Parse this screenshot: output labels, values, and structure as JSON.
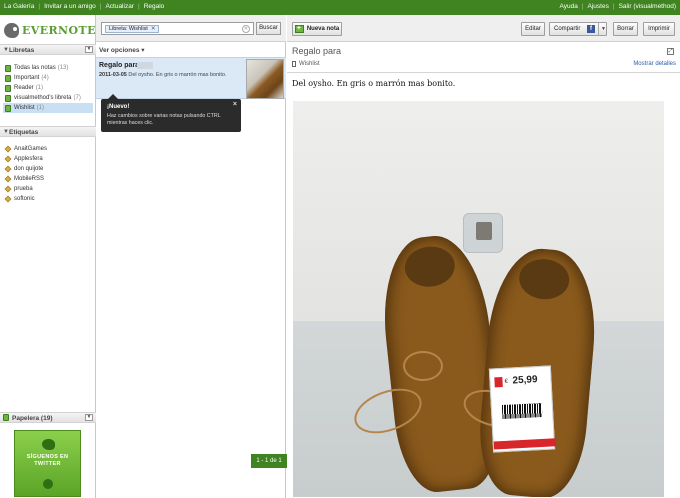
{
  "topbar": {
    "left_links": [
      "La Galería",
      "Invitar a un amigo",
      "Actualizar",
      "Regalo"
    ],
    "right_links": [
      "Ayuda",
      "Ajustes",
      "Salir (visualmethod)"
    ]
  },
  "logo": {
    "text": "EVERNOTE"
  },
  "sidebar": {
    "notebooks_header": "Libretas",
    "notebooks": [
      {
        "name": "Todas las notas",
        "count": "(13)"
      },
      {
        "name": "Important",
        "count": "(4)"
      },
      {
        "name": "Reader",
        "count": "(1)"
      },
      {
        "name": "visualmethod's libreta",
        "count": "(7)"
      },
      {
        "name": "Wishlist",
        "count": "(1)"
      }
    ],
    "tags_header": "Etiquetas",
    "tags": [
      "AnaitGames",
      "Applesfera",
      "don quijote",
      "MobileRSS",
      "prueba",
      "softonic"
    ],
    "trash_label": "Papelera",
    "trash_count": "(19)",
    "twitter_label": "SÍGUENOS EN TWITTER"
  },
  "notes_column": {
    "search_chip": "Libreta: Wishlist",
    "search_button": "Buscar",
    "view_options": "Ver opciones",
    "note": {
      "title": "Regalo para",
      "date": "2011-03-05",
      "snippet": "Del oysho. En gris o marrón mas bonito."
    },
    "tooltip_title": "¡Nuevo!",
    "tooltip_body": "Haz cambios sobre varias notas pulsando CTRL mientras haces clic.",
    "page_count": "1 - 1 de 1"
  },
  "note_pane": {
    "new_note": "Nueva nota",
    "edit": "Editar",
    "share": "Compartir",
    "delete": "Borrar",
    "print": "Imprimir",
    "title": "Regalo para",
    "notebook": "Wishlist",
    "show_details": "Mostrar detalles",
    "body": "Del oysho. En gris o marrón mas bonito.",
    "price_tag": {
      "currency": "€",
      "price": "25,99"
    }
  }
}
